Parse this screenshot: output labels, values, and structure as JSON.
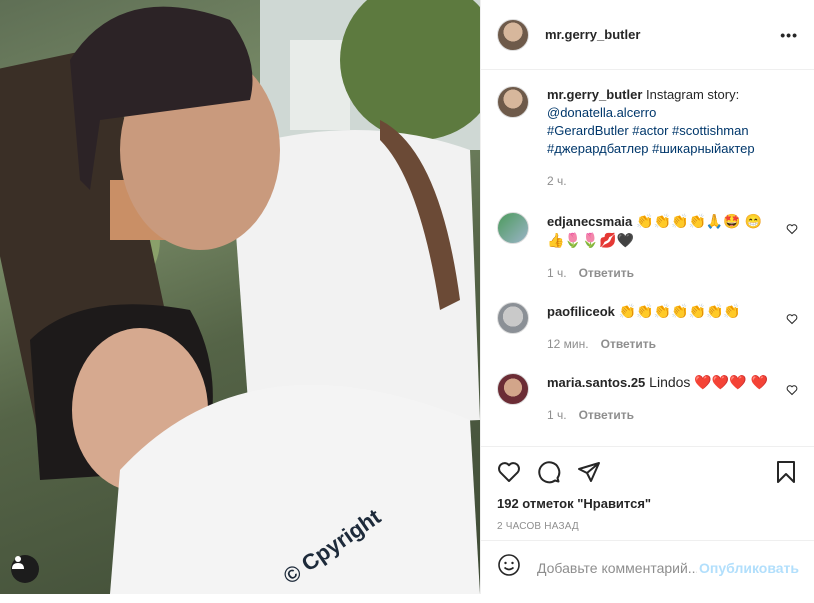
{
  "post": {
    "username": "mr.gerry_butler",
    "more_icon": "more-horizontal-icon",
    "caption": {
      "username": "mr.gerry_butler",
      "text": " Instagram story: ",
      "mention": "@donatella.alcerro",
      "hashtags_line1": "#GerardButler #actor #scottishman",
      "hashtags_line2": "#джерардбатлер #шикарныйактер",
      "time": "2 ч."
    },
    "photo_shirt_text": "© Cpyright"
  },
  "comments": [
    {
      "username": "edjanecsmaia",
      "text": " 👏👏👏👏🙏🤩 😁👍🌷🌷💋🖤",
      "time": "1 ч.",
      "reply": "Ответить"
    },
    {
      "username": "paofiliceok",
      "text": " 👏👏👏👏👏👏👏",
      "time": "12 мин.",
      "reply": "Ответить"
    },
    {
      "username": "maria.santos.25",
      "text": " Lindos ❤️❤️❤️ ❤️",
      "time": "1 ч.",
      "reply": "Ответить"
    }
  ],
  "actions": {
    "likes": "192 отметок \"Нравится\"",
    "timestamp": "2 ЧАСОВ НАЗАД"
  },
  "add_comment": {
    "placeholder": "Добавьте комментарий...",
    "post_label": "Опубликовать"
  },
  "colors": {
    "link": "#00376b",
    "muted": "#8e8e8e",
    "post_button_disabled": "#b2dffc"
  }
}
